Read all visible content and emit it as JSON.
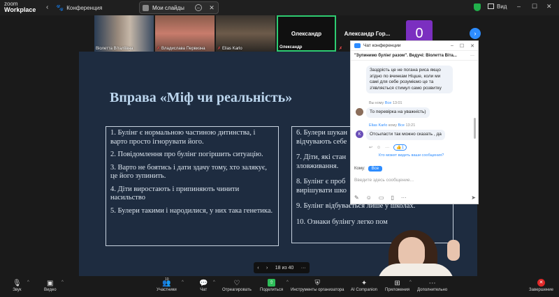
{
  "app": {
    "brand_top": "zoom",
    "brand_bottom": "Workplace"
  },
  "topbar": {
    "conference_label": "Конференция",
    "slides_label": "Мои слайды",
    "view_label": "Вид"
  },
  "participants": [
    {
      "name": "Віолетта Віталіївна",
      "muted": false
    },
    {
      "name": "Владислава Первизна",
      "muted": true
    },
    {
      "name": "Elias Karlo",
      "muted": true
    },
    {
      "name": "Олександр",
      "muted": false,
      "active_speaker": true
    },
    {
      "name": "Александр  Гор...",
      "muted": true
    },
    {
      "name": "0",
      "avatar_color": "#7b2fc0"
    }
  ],
  "slide": {
    "title": "Вправа «Міф чи реальність»",
    "left_statements": [
      "1. Булінг є нормальною частиною дитинства, і варто просто ігнорувати його.",
      "2. Повідомлення про булінг погіршить ситуацію.",
      "3. Варто не боятись і дати здачу тому, хто залякує, це його зупинить.",
      "4. Діти виростають і припиняють чинити насильство",
      "5. Булери такими і народилися, у них така генетика."
    ],
    "right_statements": [
      "6. Булери шукан",
      "відчувають себе",
      "7. Діти, які стан",
      "зловживання.",
      "8. Булінг є проб",
      "вирішувати шко",
      "9. Булінг відбувається лише у школах.",
      "10. Ознаки булінгу легко пом"
    ],
    "pager": "18 из 40"
  },
  "chat": {
    "header_title": "Чат конференции",
    "subtitle": "\"Зупинимо булінг разом\". Ведучі: Віолетта Віта...",
    "messages": [
      {
        "text": "Заздрість це не погана риса якщо згідно по вчинкам Ніцше, коли ми самі для себе розуміємо це та з'являється стимул само розвитку"
      },
      {
        "meta_prefix": "Вы кому ",
        "meta_to": "Все",
        "meta_time": " 13:01",
        "text": "То перевірка на уважність)"
      },
      {
        "meta_from": "Elias Karlo",
        "meta_mid": " кому ",
        "meta_to": "Все",
        "meta_time": " 13:21",
        "avatar": "K",
        "text": "Отсыласти так можно сказать , да"
      }
    ],
    "reaction_count": "1",
    "who_seen": "Кто может видеть ваши сообщения?",
    "to_label": "Кому:",
    "to_value": "Все",
    "input_placeholder": "Введите здесь сообщение..."
  },
  "toolbar": {
    "audio": "Звук",
    "video": "Видео",
    "participants": "Участники",
    "participants_count": "10",
    "chat": "Чат",
    "react": "Отреагировать",
    "share": "Поделиться",
    "host_tools": "Инструменты организатора",
    "ai": "AI Companion",
    "apps": "Приложения",
    "more": "Дополнительно",
    "end": "Завершение"
  }
}
